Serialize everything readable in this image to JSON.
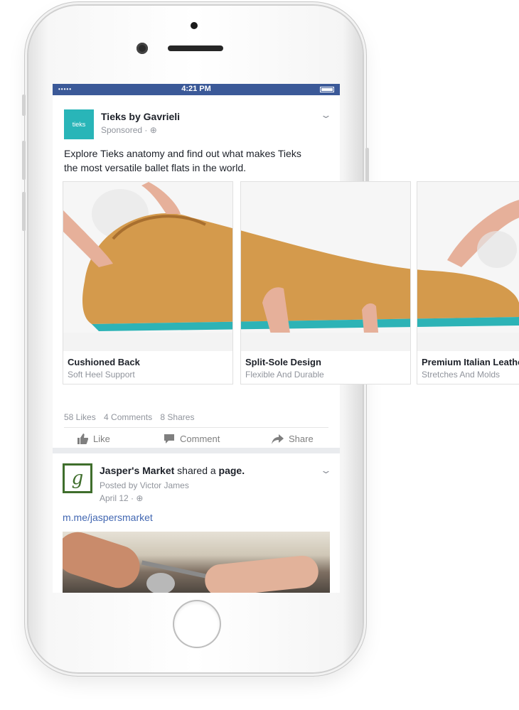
{
  "statusbar": {
    "signal": "•••••",
    "time": "4:21 PM"
  },
  "post1": {
    "page_name": "Tieks by Gavrieli",
    "logo_text": "tieks",
    "meta": "Sponsored · ",
    "text": "Explore Tieks anatomy and find out what makes Tieks the most versatile ballet flats in the world.",
    "cards": [
      {
        "title": "Cushioned Back",
        "subtitle": "Soft Heel Support"
      },
      {
        "title": "Split-Sole Design",
        "subtitle": "Flexible And Durable"
      },
      {
        "title": "Premium Italian Leather",
        "subtitle": "Stretches And Molds"
      }
    ],
    "stats": {
      "likes": "58 Likes",
      "comments": "4 Comments",
      "shares": "8 Shares"
    },
    "actions": {
      "like": "Like",
      "comment": "Comment",
      "share": "Share"
    }
  },
  "post2": {
    "logo_letter": "g",
    "page_name": "Jasper's Market",
    "shared_text": "shared a",
    "object": "page.",
    "posted_by": "Posted by Victor James",
    "date": "April 12 · ",
    "link": "m.me/jaspersmarket"
  },
  "colors": {
    "fb_blue": "#3b5998",
    "tieks_teal": "#29b5b8",
    "jasper_green": "#3f6e2c",
    "leather": "#d49a4c"
  }
}
